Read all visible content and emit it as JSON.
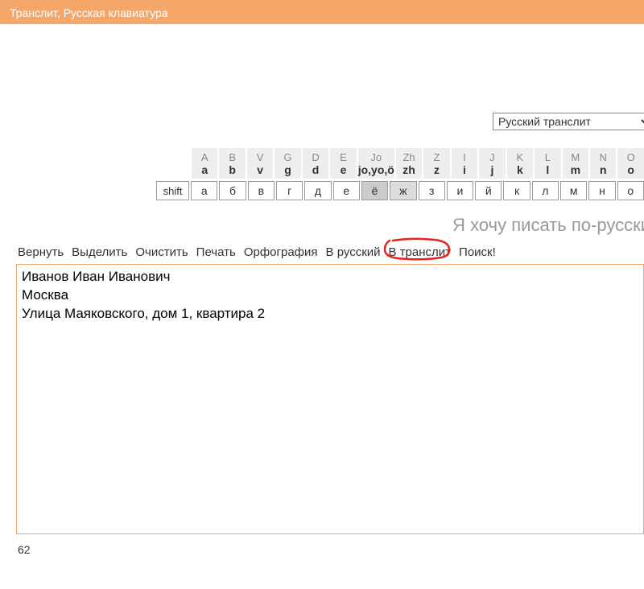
{
  "header": {
    "title": "Транслит, Русская клавиатура"
  },
  "mode_select": {
    "selected": "Русский транслит"
  },
  "keymap": {
    "top": [
      {
        "l": "A",
        "b": "a"
      },
      {
        "l": "B",
        "b": "b"
      },
      {
        "l": "V",
        "b": "v"
      },
      {
        "l": "G",
        "b": "g"
      },
      {
        "l": "D",
        "b": "d"
      },
      {
        "l": "E",
        "b": "e"
      },
      {
        "l": "Jo",
        "b": "jo,yo,ö",
        "wide": true
      },
      {
        "l": "Zh",
        "b": "zh"
      },
      {
        "l": "Z",
        "b": "z"
      },
      {
        "l": "I",
        "b": "i"
      },
      {
        "l": "J",
        "b": "j"
      },
      {
        "l": "K",
        "b": "k"
      },
      {
        "l": "L",
        "b": "l"
      },
      {
        "l": "M",
        "b": "m"
      },
      {
        "l": "N",
        "b": "n"
      },
      {
        "l": "O",
        "b": "o"
      }
    ],
    "keys": [
      {
        "label": "shift",
        "cls": "shift"
      },
      {
        "label": "а"
      },
      {
        "label": "б"
      },
      {
        "label": "в"
      },
      {
        "label": "г"
      },
      {
        "label": "д"
      },
      {
        "label": "е"
      },
      {
        "label": "ё",
        "cls": "hl1"
      },
      {
        "label": "ж",
        "cls": "hl2"
      },
      {
        "label": "з"
      },
      {
        "label": "и"
      },
      {
        "label": "й"
      },
      {
        "label": "к"
      },
      {
        "label": "л"
      },
      {
        "label": "м"
      },
      {
        "label": "н"
      },
      {
        "label": "о"
      }
    ]
  },
  "tagline": "Я хочу писать по-русски",
  "toolbar": {
    "items": [
      "Вернуть",
      "Выделить",
      "Очистить",
      "Печать",
      "Орфография",
      "В русский",
      "В транслит",
      "Поиск!"
    ]
  },
  "editor": {
    "value": "Иванов Иван Иванович\nМосква\nУлица Маяковского, дом 1, квартира 2"
  },
  "counter": "62"
}
